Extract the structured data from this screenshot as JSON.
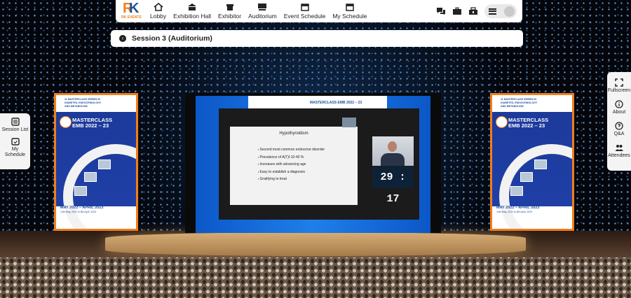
{
  "brand": {
    "logo_text": "RK",
    "logo_sub": "RK EVENTS"
  },
  "nav": {
    "items": [
      {
        "label": "Lobby",
        "icon": "home-icon"
      },
      {
        "label": "Exhibition Hall",
        "icon": "exhibition-hall-icon"
      },
      {
        "label": "Exhibitor",
        "icon": "exhibitor-icon"
      },
      {
        "label": "Auditorium",
        "icon": "auditorium-icon"
      },
      {
        "label": "Event Schedule",
        "icon": "calendar-icon"
      },
      {
        "label": "My Schedule",
        "icon": "calendar-icon"
      }
    ],
    "right_icons": [
      "chat-icon",
      "briefcase-icon",
      "toolkit-icon",
      "menu-icon"
    ]
  },
  "session": {
    "title": "Session 3 (Auditorium)"
  },
  "left_tabs": [
    {
      "label": "Session List",
      "icon": "list-icon"
    },
    {
      "label": "My Schedule",
      "icon": "calendar-icon"
    }
  ],
  "right_tabs": [
    {
      "label": "Fullscreen",
      "icon": "fullscreen-icon"
    },
    {
      "label": "About",
      "icon": "info-icon"
    },
    {
      "label": "Q&A",
      "icon": "qa-icon"
    },
    {
      "label": "Attendees",
      "icon": "attendees-icon"
    }
  ],
  "banner": {
    "header": "11 MASTERCLASS SERIES IN DIABETES, ENDOCRINOLOGY AND METABOLISM",
    "title_line1": "MASTERCLASS",
    "title_line2": "EMB 2022 – 23",
    "dates": "MAY 2022 – APRIL 2023",
    "dates_sub": "14th May, 2022 to 8th April, 2023"
  },
  "screen": {
    "header_title": "MASTERCLASS EMB 2022 – 23",
    "slide_title": "Hypothyroidism",
    "slide_bullets": [
      "Second most common endocrine disorder",
      "Prevalence of A(T)I:10-40 %",
      "Increases with advancing age",
      "Easy to establish a diagnosis",
      "Gratifying to treat"
    ],
    "timer": "29 : 17"
  },
  "colors": {
    "accent_orange": "#f07e1d",
    "brand_blue": "#1d4f9a",
    "screen_blue": "#1f7fe8"
  }
}
